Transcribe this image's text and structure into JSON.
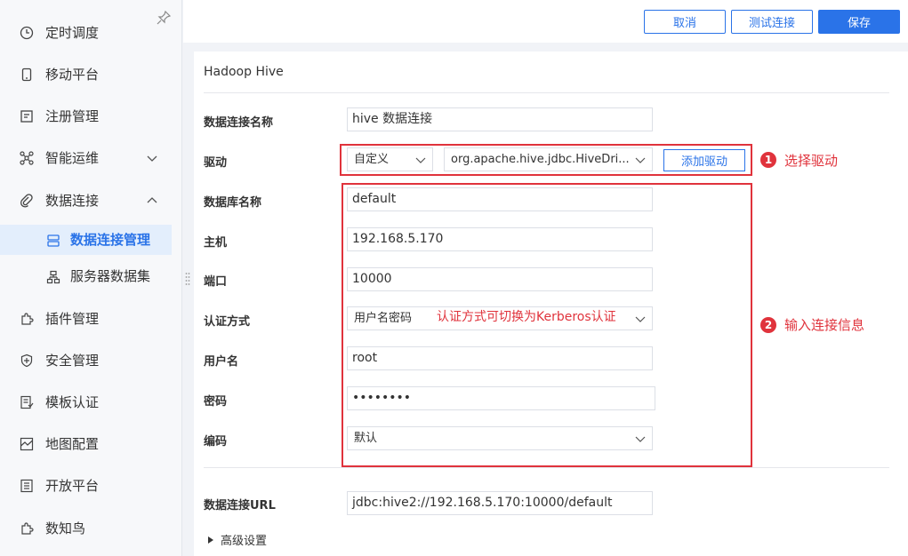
{
  "sidebar": {
    "items": [
      {
        "label": "定时调度",
        "icon": "clock-icon"
      },
      {
        "label": "移动平台",
        "icon": "mobile-icon"
      },
      {
        "label": "注册管理",
        "icon": "register-icon"
      },
      {
        "label": "智能运维",
        "icon": "ops-icon",
        "expanded": false
      },
      {
        "label": "数据连接",
        "icon": "link-icon",
        "expanded": true
      },
      {
        "label": "插件管理",
        "icon": "plugin-icon"
      },
      {
        "label": "安全管理",
        "icon": "shield-icon"
      },
      {
        "label": "模板认证",
        "icon": "template-icon"
      },
      {
        "label": "地图配置",
        "icon": "map-icon"
      },
      {
        "label": "开放平台",
        "icon": "open-platform-icon"
      },
      {
        "label": "数知鸟",
        "icon": "bird-icon"
      }
    ],
    "sub_items": [
      {
        "label": "数据连接管理",
        "icon": "db-conn-icon",
        "active": true
      },
      {
        "label": "服务器数据集",
        "icon": "server-dataset-icon",
        "active": false
      }
    ]
  },
  "toolbar": {
    "cancel_label": "取消",
    "test_label": "测试连接",
    "save_label": "保存"
  },
  "form": {
    "title": "Hadoop Hive",
    "conn_name_label": "数据连接名称",
    "conn_name_value": "hive 数据连接",
    "driver_label": "驱动",
    "driver_mode": "自定义",
    "driver_class": "org.apache.hive.jdbc.HiveDri...",
    "add_driver_label": "添加驱动",
    "db_name_label": "数据库名称",
    "db_name_value": "default",
    "host_label": "主机",
    "host_value": "192.168.5.170",
    "port_label": "端口",
    "port_value": "10000",
    "auth_label": "认证方式",
    "auth_value": "用户名密码",
    "user_label": "用户名",
    "user_value": "root",
    "password_label": "密码",
    "password_value": "••••••••",
    "encoding_label": "编码",
    "encoding_value": "默认",
    "url_label": "数据连接URL",
    "url_value": "jdbc:hive2://192.168.5.170:10000/default",
    "advanced_label": "高级设置"
  },
  "annotations": {
    "badge1": "1",
    "text1": "选择驱动",
    "badge2": "2",
    "text2": "输入连接信息",
    "auth_note": "认证方式可切换为Kerberos认证"
  },
  "colors": {
    "accent": "#2a73e8",
    "annotation": "#e0333c",
    "active_bg": "#e3eefc"
  }
}
